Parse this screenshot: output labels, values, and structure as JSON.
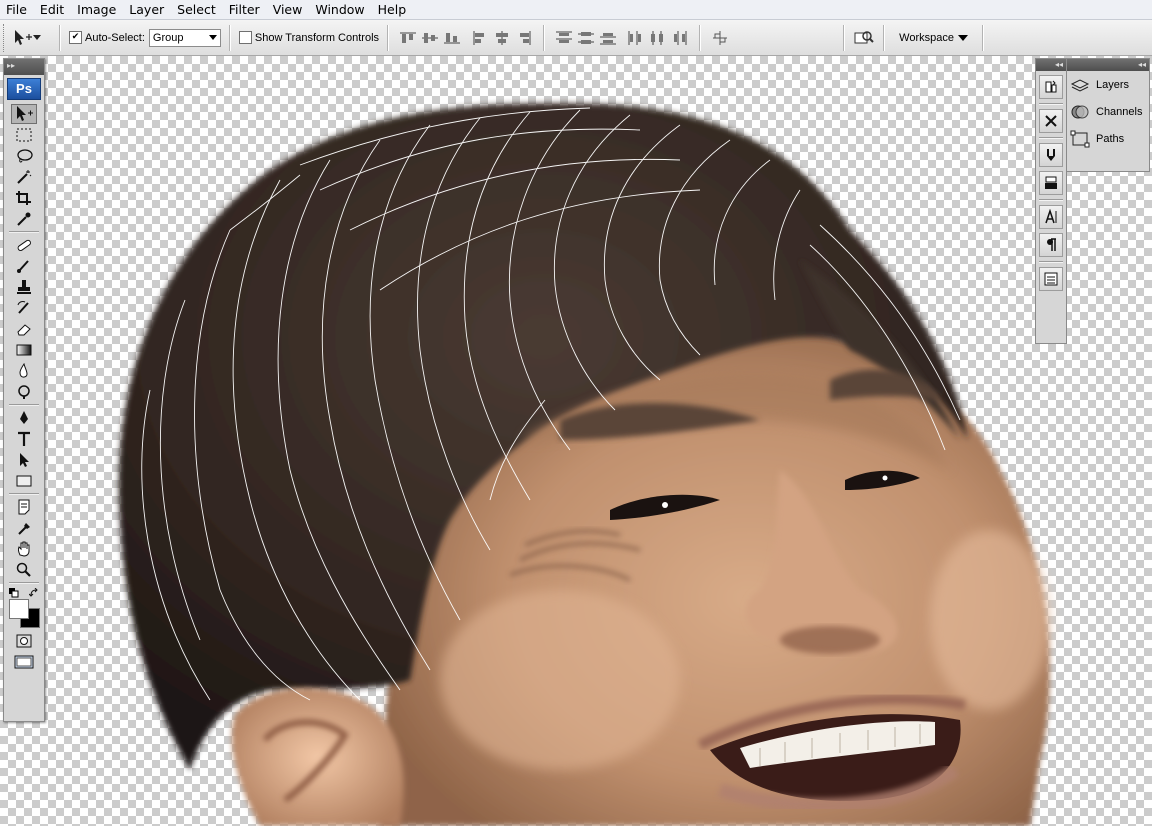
{
  "menu": {
    "items": [
      "File",
      "Edit",
      "Image",
      "Layer",
      "Select",
      "Filter",
      "View",
      "Window",
      "Help"
    ]
  },
  "options": {
    "auto_select_label": "Auto-Select:",
    "auto_select_checked": true,
    "auto_select_value": "Group",
    "show_transform_label": "Show Transform Controls",
    "show_transform_checked": false,
    "workspace_label": "Workspace"
  },
  "toolbox": {
    "logo": "Ps",
    "tools": [
      "move-tool",
      "marquee-tool",
      "lasso-tool",
      "magic-wand-tool",
      "crop-tool",
      "eyedropper-tool",
      "healing-brush-tool",
      "brush-tool",
      "clone-stamp-tool",
      "history-brush-tool",
      "eraser-tool",
      "gradient-tool",
      "blur-tool",
      "dodge-tool",
      "pen-tool",
      "type-tool",
      "path-selection-tool",
      "rectangle-tool",
      "notes-tool",
      "eyedropper-tool-2",
      "hand-tool",
      "zoom-tool"
    ],
    "foreground_color": "#ffffff",
    "background_color": "#000000"
  },
  "panels": {
    "items": [
      "Layers",
      "Channels",
      "Paths"
    ]
  },
  "colors": {
    "hair": "#2e241f",
    "skin": "#c89a78",
    "lips": "#b07a6a"
  }
}
